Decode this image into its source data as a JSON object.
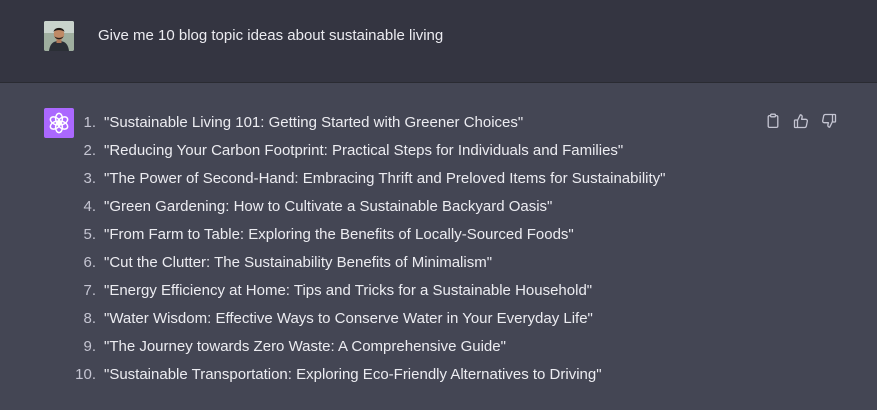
{
  "user": {
    "avatar_icon": "user-photo-avatar",
    "message": "Give me 10 blog topic ideas about sustainable living"
  },
  "assistant": {
    "avatar_icon": "openai-logo-icon",
    "avatar_color": "#ab68ff",
    "actions": [
      {
        "name": "copy-icon",
        "label": "Copy"
      },
      {
        "name": "thumbs-up-icon",
        "label": "Like"
      },
      {
        "name": "thumbs-down-icon",
        "label": "Dislike"
      }
    ],
    "items": [
      {
        "num": "1.",
        "text": "\"Sustainable Living 101: Getting Started with Greener Choices\""
      },
      {
        "num": "2.",
        "text": "\"Reducing Your Carbon Footprint: Practical Steps for Individuals and Families\""
      },
      {
        "num": "3.",
        "text": "\"The Power of Second-Hand: Embracing Thrift and Preloved Items for Sustainability\""
      },
      {
        "num": "4.",
        "text": "\"Green Gardening: How to Cultivate a Sustainable Backyard Oasis\""
      },
      {
        "num": "5.",
        "text": "\"From Farm to Table: Exploring the Benefits of Locally-Sourced Foods\""
      },
      {
        "num": "6.",
        "text": "\"Cut the Clutter: The Sustainability Benefits of Minimalism\""
      },
      {
        "num": "7.",
        "text": "\"Energy Efficiency at Home: Tips and Tricks for a Sustainable Household\""
      },
      {
        "num": "8.",
        "text": "\"Water Wisdom: Effective Ways to Conserve Water in Your Everyday Life\""
      },
      {
        "num": "9.",
        "text": "\"The Journey towards Zero Waste: A Comprehensive Guide\""
      },
      {
        "num": "10.",
        "text": "\"Sustainable Transportation: Exploring Eco-Friendly Alternatives to Driving\""
      }
    ]
  },
  "colors": {
    "user_bg": "#343541",
    "assistant_bg": "#444654",
    "text": "#ececf1",
    "icon": "#c5c5d2"
  }
}
